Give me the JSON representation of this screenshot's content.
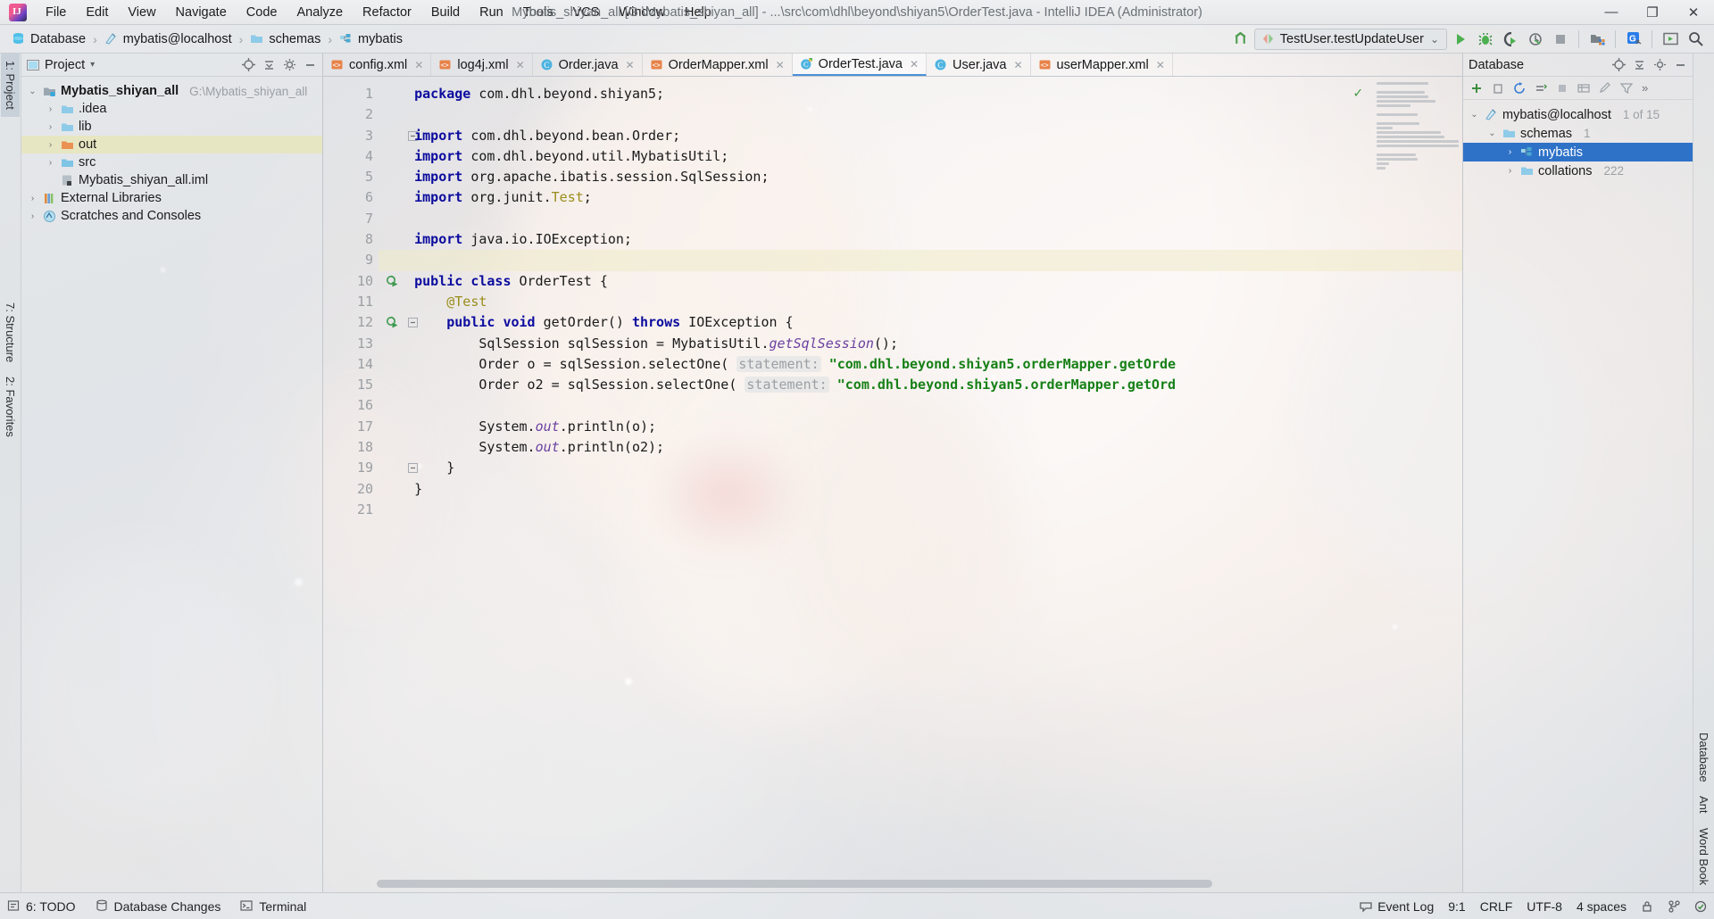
{
  "window": {
    "title": "Mybatis_shiyan_all [G:\\Mybatis_shiyan_all] - ...\\src\\com\\dhl\\beyond\\shiyan5\\OrderTest.java - IntelliJ IDEA (Administrator)",
    "minimize": "—",
    "maximize": "❐",
    "close": "✕"
  },
  "menu": [
    "File",
    "Edit",
    "View",
    "Navigate",
    "Code",
    "Analyze",
    "Refactor",
    "Build",
    "Run",
    "Tools",
    "VCS",
    "Window",
    "Help"
  ],
  "navbar": {
    "breadcrumbs": [
      {
        "label": "Database",
        "icon": "database-icon"
      },
      {
        "label": "mybatis@localhost",
        "icon": "datasource-icon"
      },
      {
        "label": "schemas",
        "icon": "folder-icon"
      },
      {
        "label": "mybatis",
        "icon": "schema-icon"
      }
    ],
    "separator": "›",
    "run_config": "TestUser.testUpdateUser",
    "run_config_chevron": "⌄",
    "icons": [
      "build-icon",
      "run-icon",
      "debug-icon",
      "run-with-coverage-icon",
      "profile-icon",
      "stop-icon",
      "open-folder-icon",
      "google-icon",
      "presentation-icon",
      "search-everywhere-icon"
    ]
  },
  "left_rail": [
    {
      "label": "1: Project",
      "selected": true
    },
    {
      "label": "7: Structure",
      "selected": false
    },
    {
      "label": "2: Favorites",
      "selected": false
    }
  ],
  "right_rail": [
    {
      "label": "Database",
      "selected": false
    },
    {
      "label": "Ant",
      "selected": false
    },
    {
      "label": "Word Book",
      "selected": false
    }
  ],
  "project_panel": {
    "title": "Project",
    "chevron": "▾",
    "header_icons": [
      "locate-icon",
      "collapse-all-icon",
      "settings-icon",
      "hide-icon"
    ],
    "tree": [
      {
        "indent": 0,
        "arrow": "⌄",
        "icon": "module-icon",
        "label": "Mybatis_shiyan_all",
        "sub": "G:\\Mybatis_shiyan_all",
        "bold": true,
        "highlight": false
      },
      {
        "indent": 1,
        "arrow": "›",
        "icon": "folder-icon",
        "label": ".idea",
        "sub": "",
        "bold": false,
        "highlight": false
      },
      {
        "indent": 1,
        "arrow": "›",
        "icon": "folder-icon",
        "label": "lib",
        "sub": "",
        "bold": false,
        "highlight": false
      },
      {
        "indent": 1,
        "arrow": "›",
        "icon": "folder-orange-icon",
        "label": "out",
        "sub": "",
        "bold": false,
        "highlight": true
      },
      {
        "indent": 1,
        "arrow": "›",
        "icon": "folder-src-icon",
        "label": "src",
        "sub": "",
        "bold": false,
        "highlight": false
      },
      {
        "indent": 1,
        "arrow": "",
        "icon": "iml-file-icon",
        "label": "Mybatis_shiyan_all.iml",
        "sub": "",
        "bold": false,
        "highlight": false
      },
      {
        "indent": 0,
        "arrow": "›",
        "icon": "libraries-icon",
        "label": "External Libraries",
        "sub": "",
        "bold": false,
        "highlight": false
      },
      {
        "indent": 0,
        "arrow": "›",
        "icon": "scratches-icon",
        "label": "Scratches and Consoles",
        "sub": "",
        "bold": false,
        "highlight": false
      }
    ]
  },
  "editor": {
    "tabs": [
      {
        "label": "config.xml",
        "icon": "xml-file-icon",
        "active": false,
        "close": "✕"
      },
      {
        "label": "log4j.xml",
        "icon": "xml-file-icon",
        "active": false,
        "close": "✕"
      },
      {
        "label": "Order.java",
        "icon": "java-class-icon",
        "active": false,
        "close": "✕"
      },
      {
        "label": "OrderMapper.xml",
        "icon": "xml-file-icon",
        "active": false,
        "close": "✕"
      },
      {
        "label": "OrderTest.java",
        "icon": "java-test-icon",
        "active": true,
        "close": "✕"
      },
      {
        "label": "User.java",
        "icon": "java-class-icon",
        "active": false,
        "close": "✕"
      },
      {
        "label": "userMapper.xml",
        "icon": "xml-file-icon",
        "active": false,
        "close": "✕"
      }
    ],
    "inspection_ok": "✓",
    "lines": [
      {
        "n": "1",
        "gutter": "",
        "fold": "",
        "cursor": false,
        "tokens": [
          {
            "t": "    ",
            "c": ""
          },
          {
            "t": "package",
            "c": "kw"
          },
          {
            "t": " com.dhl.beyond.shiyan5;",
            "c": ""
          }
        ]
      },
      {
        "n": "2",
        "gutter": "",
        "fold": "",
        "cursor": false,
        "tokens": []
      },
      {
        "n": "3",
        "gutter": "",
        "fold": "minus",
        "cursor": false,
        "tokens": [
          {
            "t": "    ",
            "c": ""
          },
          {
            "t": "import",
            "c": "kw"
          },
          {
            "t": " com.dhl.beyond.bean.Order;",
            "c": ""
          }
        ]
      },
      {
        "n": "4",
        "gutter": "",
        "fold": "",
        "cursor": false,
        "tokens": [
          {
            "t": "    ",
            "c": ""
          },
          {
            "t": "import",
            "c": "kw"
          },
          {
            "t": " com.dhl.beyond.util.MybatisUtil;",
            "c": ""
          }
        ]
      },
      {
        "n": "5",
        "gutter": "",
        "fold": "",
        "cursor": false,
        "tokens": [
          {
            "t": "    ",
            "c": ""
          },
          {
            "t": "import",
            "c": "kw"
          },
          {
            "t": " org.apache.ibatis.session.SqlSession;",
            "c": ""
          }
        ]
      },
      {
        "n": "6",
        "gutter": "",
        "fold": "",
        "cursor": false,
        "tokens": [
          {
            "t": "    ",
            "c": ""
          },
          {
            "t": "import",
            "c": "kw"
          },
          {
            "t": " org.junit.",
            "c": ""
          },
          {
            "t": "Test",
            "c": "ann"
          },
          {
            "t": ";",
            "c": ""
          }
        ]
      },
      {
        "n": "7",
        "gutter": "",
        "fold": "",
        "cursor": false,
        "tokens": []
      },
      {
        "n": "8",
        "gutter": "",
        "fold": "",
        "cursor": false,
        "tokens": [
          {
            "t": "    ",
            "c": ""
          },
          {
            "t": "import",
            "c": "kw"
          },
          {
            "t": " java.io.IOException;",
            "c": ""
          }
        ]
      },
      {
        "n": "9",
        "gutter": "",
        "fold": "",
        "cursor": true,
        "tokens": []
      },
      {
        "n": "10",
        "gutter": "run-test-icon",
        "fold": "",
        "cursor": false,
        "tokens": [
          {
            "t": "    ",
            "c": ""
          },
          {
            "t": "public class",
            "c": "kw"
          },
          {
            "t": " OrderTest {",
            "c": ""
          }
        ]
      },
      {
        "n": "11",
        "gutter": "",
        "fold": "",
        "cursor": false,
        "tokens": [
          {
            "t": "        ",
            "c": ""
          },
          {
            "t": "@Test",
            "c": "ann"
          }
        ]
      },
      {
        "n": "12",
        "gutter": "run-test-icon",
        "fold": "minus",
        "cursor": false,
        "tokens": [
          {
            "t": "        ",
            "c": ""
          },
          {
            "t": "public void",
            "c": "kw"
          },
          {
            "t": " getOrder() ",
            "c": ""
          },
          {
            "t": "throws",
            "c": "kw"
          },
          {
            "t": " IOException {",
            "c": ""
          }
        ]
      },
      {
        "n": "13",
        "gutter": "",
        "fold": "",
        "cursor": false,
        "tokens": [
          {
            "t": "            SqlSession sqlSession = MybatisUtil.",
            "c": ""
          },
          {
            "t": "getSqlSession",
            "c": "fld"
          },
          {
            "t": "();",
            "c": ""
          }
        ]
      },
      {
        "n": "14",
        "gutter": "",
        "fold": "",
        "cursor": false,
        "tokens": [
          {
            "t": "            Order o = sqlSession.selectOne( ",
            "c": ""
          },
          {
            "t": "statement:",
            "c": "hint"
          },
          {
            "t": " ",
            "c": ""
          },
          {
            "t": "\"com.dhl.beyond.shiyan5.orderMapper.getOrde",
            "c": "str"
          }
        ]
      },
      {
        "n": "15",
        "gutter": "",
        "fold": "",
        "cursor": false,
        "tokens": [
          {
            "t": "            Order o2 = sqlSession.selectOne( ",
            "c": ""
          },
          {
            "t": "statement:",
            "c": "hint"
          },
          {
            "t": " ",
            "c": ""
          },
          {
            "t": "\"com.dhl.beyond.shiyan5.orderMapper.getOrd",
            "c": "str"
          }
        ]
      },
      {
        "n": "16",
        "gutter": "",
        "fold": "",
        "cursor": false,
        "tokens": []
      },
      {
        "n": "17",
        "gutter": "",
        "fold": "",
        "cursor": false,
        "tokens": [
          {
            "t": "            System.",
            "c": ""
          },
          {
            "t": "out",
            "c": "fld"
          },
          {
            "t": ".println(o);",
            "c": ""
          }
        ]
      },
      {
        "n": "18",
        "gutter": "",
        "fold": "",
        "cursor": false,
        "tokens": [
          {
            "t": "            System.",
            "c": ""
          },
          {
            "t": "out",
            "c": "fld"
          },
          {
            "t": ".println(o2);",
            "c": ""
          }
        ]
      },
      {
        "n": "19",
        "gutter": "",
        "fold": "minus",
        "cursor": false,
        "tokens": [
          {
            "t": "        }",
            "c": ""
          }
        ]
      },
      {
        "n": "20",
        "gutter": "",
        "fold": "",
        "cursor": false,
        "tokens": [
          {
            "t": "    }",
            "c": ""
          }
        ]
      },
      {
        "n": "21",
        "gutter": "",
        "fold": "",
        "cursor": false,
        "tokens": []
      }
    ]
  },
  "database_panel": {
    "title": "Database",
    "header_icons": [
      "expand-icon",
      "collapse-icon",
      "settings-icon",
      "hide-icon"
    ],
    "toolbar_icons": [
      "add-icon",
      "remove-icon",
      "refresh-icon",
      "sync-icon",
      "stop-icon",
      "table-icon",
      "edit-icon",
      "filter-icon",
      "more-icon"
    ],
    "tree": [
      {
        "indent": 0,
        "arrow": "⌄",
        "icon": "datasource-icon",
        "label": "mybatis@localhost",
        "sub": "1 of 15",
        "selected": false
      },
      {
        "indent": 1,
        "arrow": "⌄",
        "icon": "folder-icon",
        "label": "schemas",
        "sub": "1",
        "selected": false
      },
      {
        "indent": 2,
        "arrow": "›",
        "icon": "schema-icon",
        "label": "mybatis",
        "sub": "",
        "selected": true
      },
      {
        "indent": 2,
        "arrow": "›",
        "icon": "folder-icon",
        "label": "collations",
        "sub": "222",
        "selected": false
      }
    ]
  },
  "status_bar": {
    "left": [
      {
        "label": "6: TODO",
        "icon": "todo-icon"
      },
      {
        "label": "Database Changes",
        "icon": "db-changes-icon"
      },
      {
        "label": "Terminal",
        "icon": "terminal-icon"
      }
    ],
    "event_log": "Event Log",
    "event_log_icon": "balloon-icon",
    "position": "9:1",
    "line_separator": "CRLF",
    "encoding": "UTF-8",
    "indent": "4 spaces",
    "right_icons": [
      "lock-icon",
      "branch-icon",
      "inspection-icon"
    ]
  }
}
